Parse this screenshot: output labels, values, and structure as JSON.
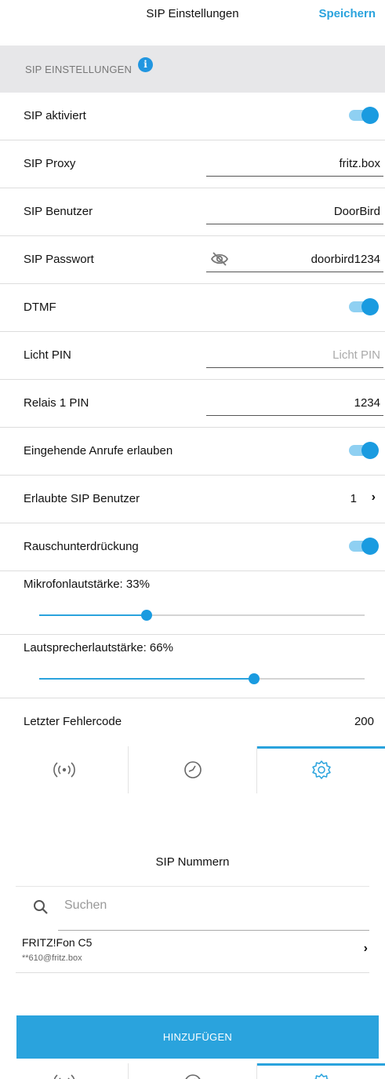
{
  "screen1": {
    "title": "SIP Einstellungen",
    "save_label": "Speichern",
    "section_label": "SIP EINSTELLUNGEN",
    "info_glyph": "i",
    "rows": {
      "sip_enabled": {
        "label": "SIP aktiviert",
        "on": true
      },
      "proxy": {
        "label": "SIP Proxy",
        "value": "fritz.box"
      },
      "user": {
        "label": "SIP Benutzer",
        "value": "DoorBird"
      },
      "password": {
        "label": "SIP Passwort",
        "value": "doorbird1234"
      },
      "dtmf": {
        "label": "DTMF",
        "on": true
      },
      "light_pin": {
        "label": "Licht PIN",
        "placeholder": "Licht PIN"
      },
      "relay_pin": {
        "label": "Relais 1 PIN",
        "value": "1234"
      },
      "incoming_calls": {
        "label": "Eingehende Anrufe erlauben",
        "on": true
      },
      "allowed_users": {
        "label": "Erlaubte SIP Benutzer",
        "count": "1",
        "chevron": "›"
      },
      "noise_suppression": {
        "label": "Rauschunterdrückung",
        "on": true
      },
      "mic_volume": {
        "label": "Mikrofonlautstärke: 33%",
        "percent": 33
      },
      "speaker_volume": {
        "label": "Lautsprecherlautstärke: 66%",
        "percent": 66
      },
      "last_error": {
        "label": "Letzter Fehlercode",
        "value": "200"
      }
    }
  },
  "screen2": {
    "title": "SIP Nummern",
    "search_placeholder": "Suchen",
    "items": [
      {
        "name": "FRITZ!Fon C5",
        "sub": "**610@fritz.box",
        "chevron": "›"
      }
    ],
    "add_button": "HINZUFÜGEN"
  },
  "tabs": [
    {
      "icon": "broadcast-icon",
      "active": false
    },
    {
      "icon": "history-clock-icon",
      "active": false
    },
    {
      "icon": "settings-gear-icon",
      "active": true
    }
  ],
  "colors": {
    "accent": "#2aa3dd",
    "section_bg": "#e7e7e9"
  }
}
